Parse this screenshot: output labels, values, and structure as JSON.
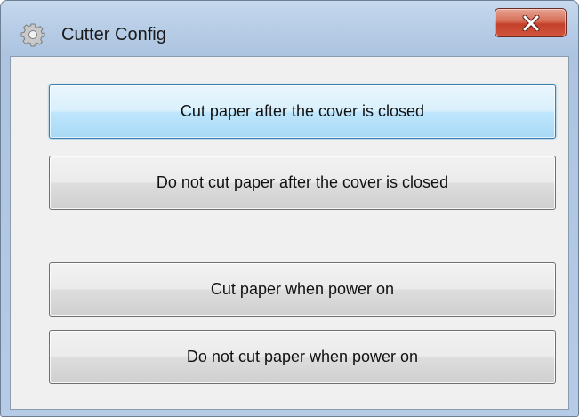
{
  "window": {
    "title": "Cutter Config",
    "title_icon": "gear-icon",
    "close_icon": "close-icon"
  },
  "buttons": [
    {
      "label": "Cut paper after the cover is closed",
      "focused": true
    },
    {
      "label": "Do not cut paper after the cover is closed",
      "focused": false
    },
    {
      "label": "Cut paper when power on",
      "focused": false
    },
    {
      "label": "Do not cut paper when power on",
      "focused": false
    }
  ],
  "colors": {
    "focus_border": "#3c7fb1",
    "close_button": "#c2402a"
  }
}
